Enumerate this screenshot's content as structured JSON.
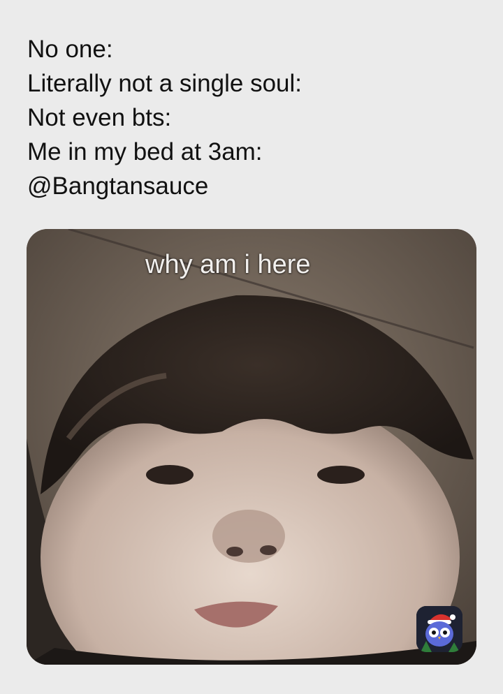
{
  "caption": {
    "lines": [
      "No one:",
      "Literally not a single soul:",
      "Not even bts:",
      "Me in my bed at 3am:",
      "@Bangtansauce"
    ]
  },
  "photo": {
    "overlay_text": "why am i here"
  },
  "badge": {
    "icon": "owl-icon"
  }
}
